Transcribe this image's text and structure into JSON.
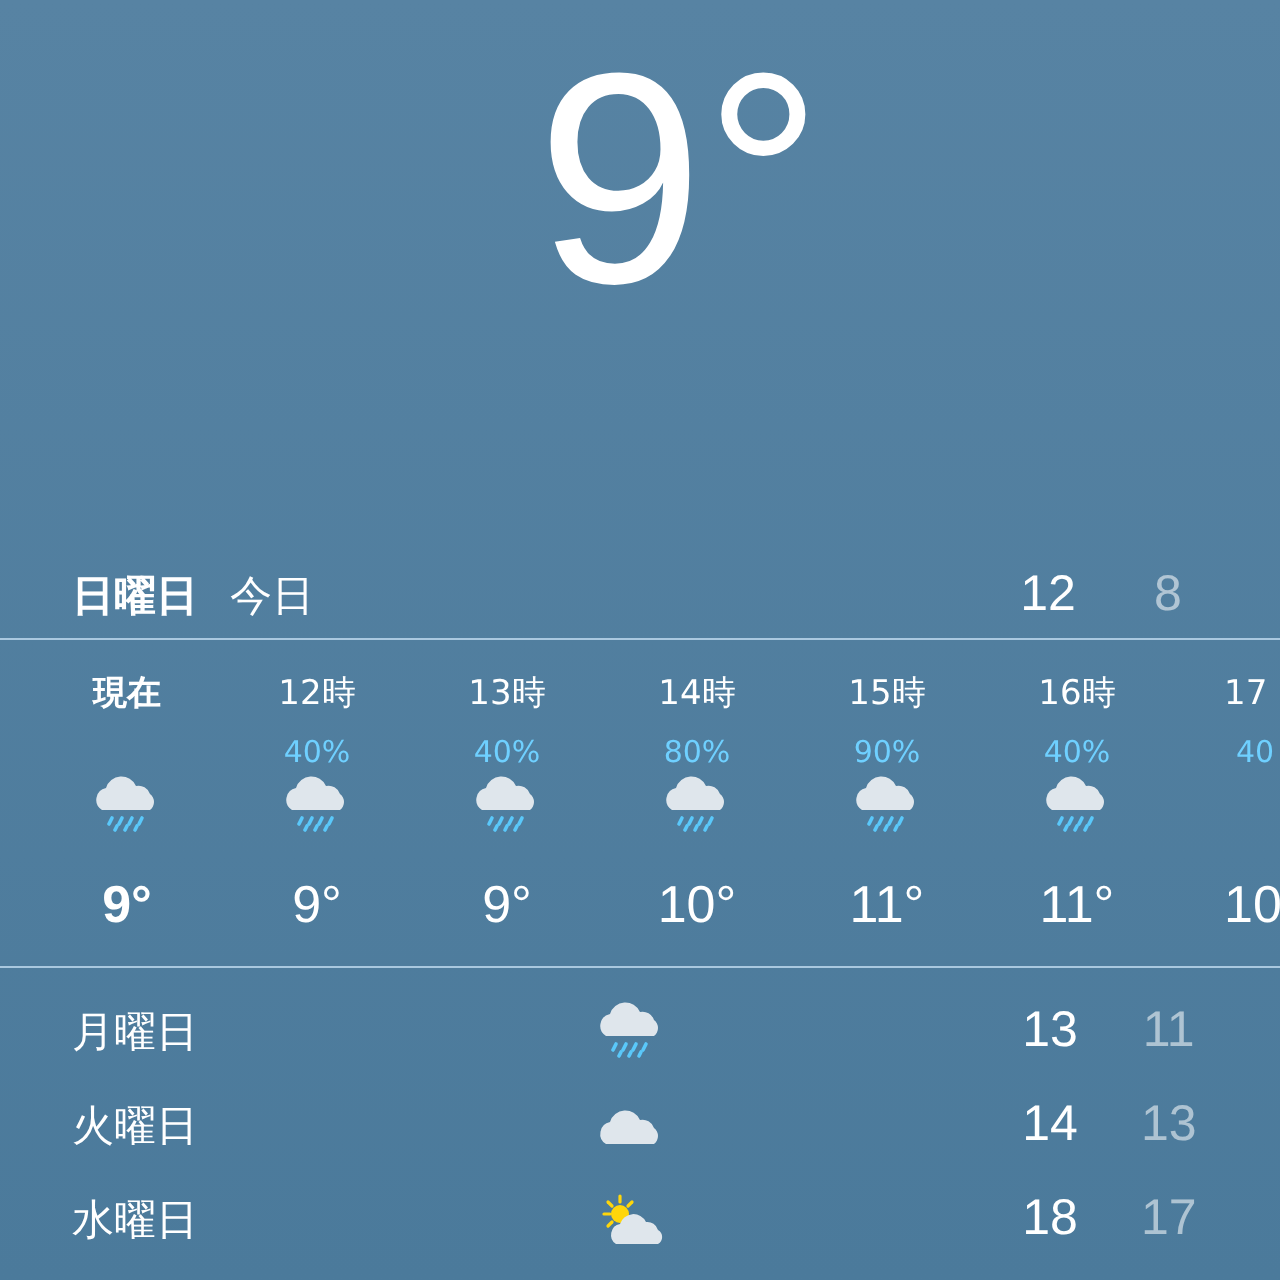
{
  "current": {
    "temperature": "9°"
  },
  "today": {
    "day": "日曜日",
    "label": "今日",
    "high": "12",
    "low": "8"
  },
  "hourly": [
    {
      "time": "現在",
      "now": true,
      "kind": "rain",
      "temperature": "9°"
    },
    {
      "time": "12時",
      "now": false,
      "precip": "40%",
      "kind": "rain",
      "temperature": "9°"
    },
    {
      "time": "13時",
      "now": false,
      "precip": "40%",
      "kind": "rain",
      "temperature": "9°"
    },
    {
      "time": "14時",
      "now": false,
      "precip": "80%",
      "kind": "rain",
      "temperature": "10°"
    },
    {
      "time": "15時",
      "now": false,
      "precip": "90%",
      "kind": "rain",
      "temperature": "11°"
    },
    {
      "time": "16時",
      "now": false,
      "precip": "40%",
      "kind": "rain",
      "temperature": "11°"
    },
    {
      "time": "17",
      "now": false,
      "precip": "40",
      "temperature": "10",
      "kind": "partial"
    }
  ],
  "daily": [
    {
      "day": "月曜日",
      "kind": "rain",
      "high": "13",
      "low": "11"
    },
    {
      "day": "火曜日",
      "kind": "cloud",
      "high": "14",
      "low": "13"
    },
    {
      "day": "水曜日",
      "kind": "sun-cloud",
      "high": "18",
      "low": "17"
    }
  ]
}
